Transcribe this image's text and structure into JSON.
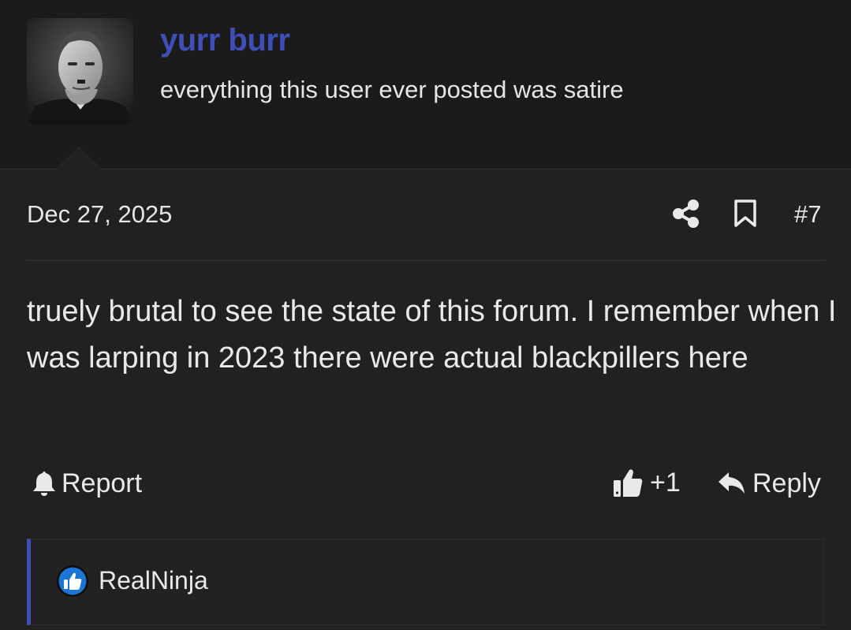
{
  "user": {
    "name": "yurr burr",
    "title": "everything this user ever posted was satire"
  },
  "post": {
    "date": "Dec 27, 2025",
    "number": "#7",
    "body": "truely brutal to see the state of this forum. I remember when I was larping in 2023 there were actual blackpillers here"
  },
  "actions": {
    "report_label": "Report",
    "plus_one_label": "+1",
    "reply_label": "Reply"
  },
  "reactions": {
    "users": [
      "RealNinja"
    ]
  },
  "icons": {
    "share": "share-icon",
    "bookmark": "bookmark-icon",
    "report": "bell-icon",
    "plus_one": "thumbs-up-icon",
    "reply": "reply-arrow-icon",
    "reaction": "like-reaction-icon"
  },
  "colors": {
    "background": "#212121",
    "header_background": "#1b1b1c",
    "username": "#3f4fb7",
    "text": "#e9e9e9",
    "reaction_accent": "#3f4fb7",
    "like_badge": "#1b75d6"
  }
}
